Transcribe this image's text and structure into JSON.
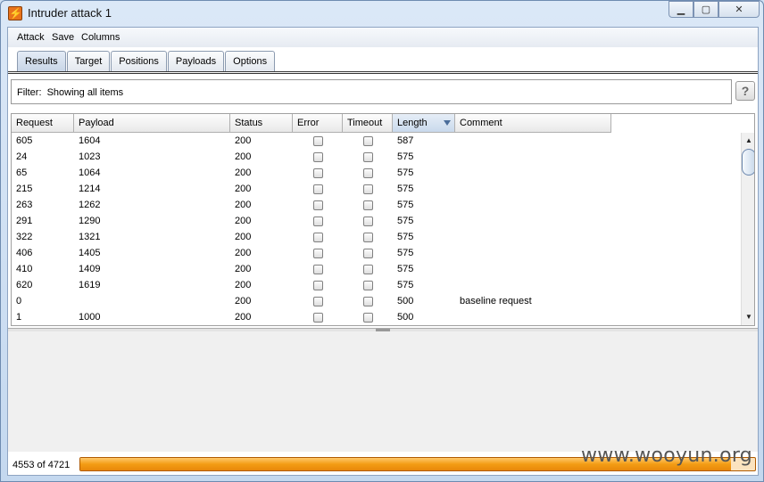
{
  "window": {
    "title": "Intruder attack 1",
    "app_icon": "burp-lightning-icon"
  },
  "menubar": {
    "items": [
      "Attack",
      "Save",
      "Columns"
    ]
  },
  "tabs": [
    {
      "label": "Results",
      "active": true
    },
    {
      "label": "Target"
    },
    {
      "label": "Positions"
    },
    {
      "label": "Payloads"
    },
    {
      "label": "Options"
    }
  ],
  "filter": {
    "label": "Filter:",
    "value": "Showing all items",
    "help": "?"
  },
  "table": {
    "columns": [
      "Request",
      "Payload",
      "Status",
      "Error",
      "Timeout",
      "Length",
      "Comment"
    ],
    "sorted_column": "Length",
    "rows": [
      {
        "request": "605",
        "payload": "1604",
        "status": "200",
        "length": "587",
        "comment": ""
      },
      {
        "request": "24",
        "payload": "1023",
        "status": "200",
        "length": "575",
        "comment": ""
      },
      {
        "request": "65",
        "payload": "1064",
        "status": "200",
        "length": "575",
        "comment": ""
      },
      {
        "request": "215",
        "payload": "1214",
        "status": "200",
        "length": "575",
        "comment": ""
      },
      {
        "request": "263",
        "payload": "1262",
        "status": "200",
        "length": "575",
        "comment": ""
      },
      {
        "request": "291",
        "payload": "1290",
        "status": "200",
        "length": "575",
        "comment": ""
      },
      {
        "request": "322",
        "payload": "1321",
        "status": "200",
        "length": "575",
        "comment": ""
      },
      {
        "request": "406",
        "payload": "1405",
        "status": "200",
        "length": "575",
        "comment": ""
      },
      {
        "request": "410",
        "payload": "1409",
        "status": "200",
        "length": "575",
        "comment": ""
      },
      {
        "request": "620",
        "payload": "1619",
        "status": "200",
        "length": "575",
        "comment": ""
      },
      {
        "request": "0",
        "payload": "",
        "status": "200",
        "length": "500",
        "comment": "baseline request"
      },
      {
        "request": "1",
        "payload": "1000",
        "status": "200",
        "length": "500",
        "comment": ""
      }
    ]
  },
  "status": {
    "text": "4553 of 4721",
    "progress": 0.964
  },
  "watermark": "www.wooyun.org",
  "colors": {
    "progress": "#f39c14",
    "selected_tab": "#c7d4e6"
  }
}
